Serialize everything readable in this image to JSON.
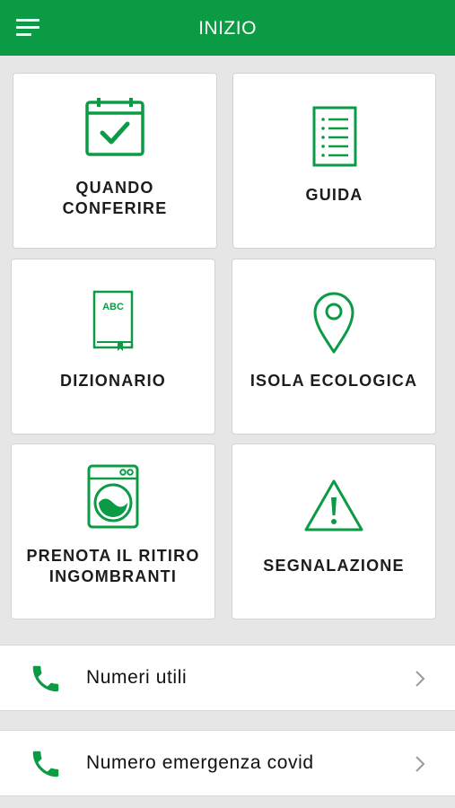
{
  "header": {
    "title": "INIZIO",
    "menu_icon": "hamburger-menu-icon"
  },
  "tiles": [
    {
      "line1": "QUANDO",
      "line2": "CONFERIRE",
      "icon": "calendar-check-icon"
    },
    {
      "line1": "GUIDA",
      "line2": "",
      "icon": "checklist-document-icon"
    },
    {
      "line1": "DIZIONARIO",
      "line2": "",
      "icon": "dictionary-book-icon",
      "icon_text": "ABC"
    },
    {
      "line1": "ISOLA ECOLOGICA",
      "line2": "",
      "icon": "map-pin-icon"
    },
    {
      "line1": "PRENOTA IL RITIRO",
      "line2": "INGOMBRANTI",
      "icon": "washing-machine-icon"
    },
    {
      "line1": "SEGNALAZIONE",
      "line2": "",
      "icon": "warning-triangle-icon"
    }
  ],
  "list": [
    {
      "label": "Numeri utili",
      "icon": "phone-icon"
    },
    {
      "label": "Numero emergenza covid",
      "icon": "phone-icon"
    }
  ],
  "colors": {
    "brand_green": "#0b9b45",
    "background": "#e6e6e6",
    "card": "#ffffff"
  }
}
